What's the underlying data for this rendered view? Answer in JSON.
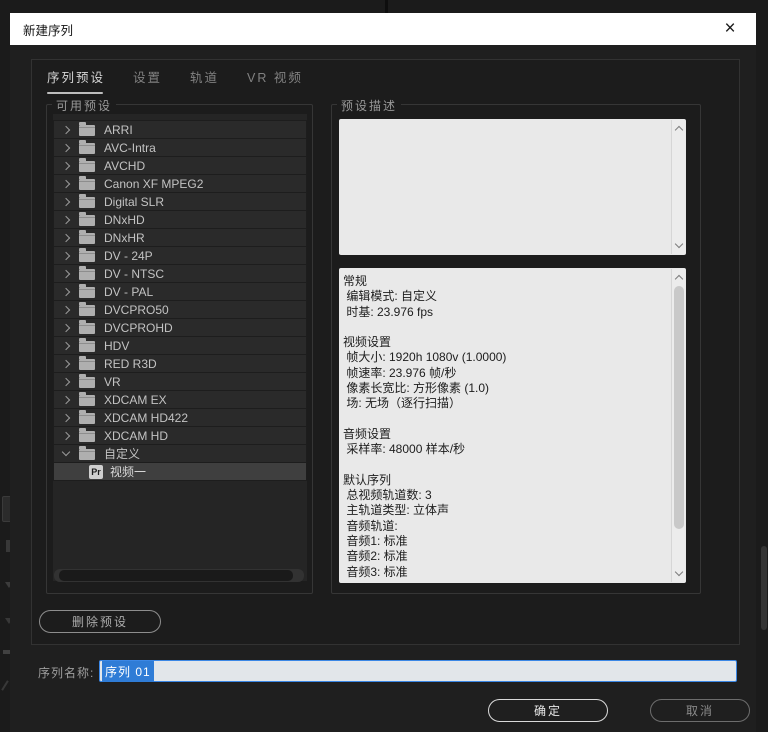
{
  "window": {
    "title": "新建序列",
    "close_glyph": "×"
  },
  "tabs": {
    "items": [
      {
        "label": "序列预设",
        "active": true
      },
      {
        "label": "设置",
        "active": false
      },
      {
        "label": "轨道",
        "active": false
      },
      {
        "label": "VR 视频",
        "active": false
      }
    ]
  },
  "available_presets": {
    "legend": "可用预设",
    "items": [
      {
        "label": "ARRI",
        "icon": "folder",
        "state": "collapsed"
      },
      {
        "label": "AVC-Intra",
        "icon": "folder",
        "state": "collapsed"
      },
      {
        "label": "AVCHD",
        "icon": "folder",
        "state": "collapsed"
      },
      {
        "label": "Canon XF MPEG2",
        "icon": "folder",
        "state": "collapsed"
      },
      {
        "label": "Digital SLR",
        "icon": "folder",
        "state": "collapsed"
      },
      {
        "label": "DNxHD",
        "icon": "folder",
        "state": "collapsed"
      },
      {
        "label": "DNxHR",
        "icon": "folder",
        "state": "collapsed"
      },
      {
        "label": "DV - 24P",
        "icon": "folder",
        "state": "collapsed"
      },
      {
        "label": "DV - NTSC",
        "icon": "folder",
        "state": "collapsed"
      },
      {
        "label": "DV - PAL",
        "icon": "folder",
        "state": "collapsed"
      },
      {
        "label": "DVCPRO50",
        "icon": "folder",
        "state": "collapsed"
      },
      {
        "label": "DVCPROHD",
        "icon": "folder",
        "state": "collapsed"
      },
      {
        "label": "HDV",
        "icon": "folder",
        "state": "collapsed"
      },
      {
        "label": "RED R3D",
        "icon": "folder",
        "state": "collapsed"
      },
      {
        "label": "VR",
        "icon": "folder",
        "state": "collapsed"
      },
      {
        "label": "XDCAM EX",
        "icon": "folder",
        "state": "collapsed"
      },
      {
        "label": "XDCAM HD422",
        "icon": "folder",
        "state": "collapsed"
      },
      {
        "label": "XDCAM HD",
        "icon": "folder",
        "state": "collapsed"
      },
      {
        "label": "自定义",
        "icon": "folder",
        "state": "expanded"
      },
      {
        "label": "视频一",
        "icon": "pr",
        "state": "selected"
      }
    ],
    "delete_button": "删除预设"
  },
  "preset_description": {
    "legend": "预设描述",
    "summary_lines": [
      "常规",
      " 编辑模式: 自定义",
      " 时基: 23.976 fps",
      "",
      "视频设置",
      " 帧大小: 1920h 1080v (1.0000)",
      " 帧速率: 23.976 帧/秒",
      " 像素长宽比: 方形像素 (1.0)",
      " 场: 无场（逐行扫描）",
      "",
      "音频设置",
      " 采样率: 48000 样本/秒",
      "",
      "默认序列",
      " 总视频轨道数: 3",
      " 主轨道类型: 立体声",
      " 音频轨道:",
      " 音频1: 标准",
      " 音频2: 标准",
      " 音频3: 标准"
    ]
  },
  "sequence_name": {
    "label": "序列名称:",
    "value": "序列 01"
  },
  "actions": {
    "ok": "确定",
    "cancel": "取消"
  },
  "icons": {
    "pr_badge": "Pr"
  },
  "colors": {
    "selection_blue": "#2f7cd6",
    "input_border_blue": "#3b87e5",
    "titlebar_bg": "#ffffff",
    "dialog_bg": "#1f1f1f",
    "description_bg": "#e9e9e9"
  }
}
